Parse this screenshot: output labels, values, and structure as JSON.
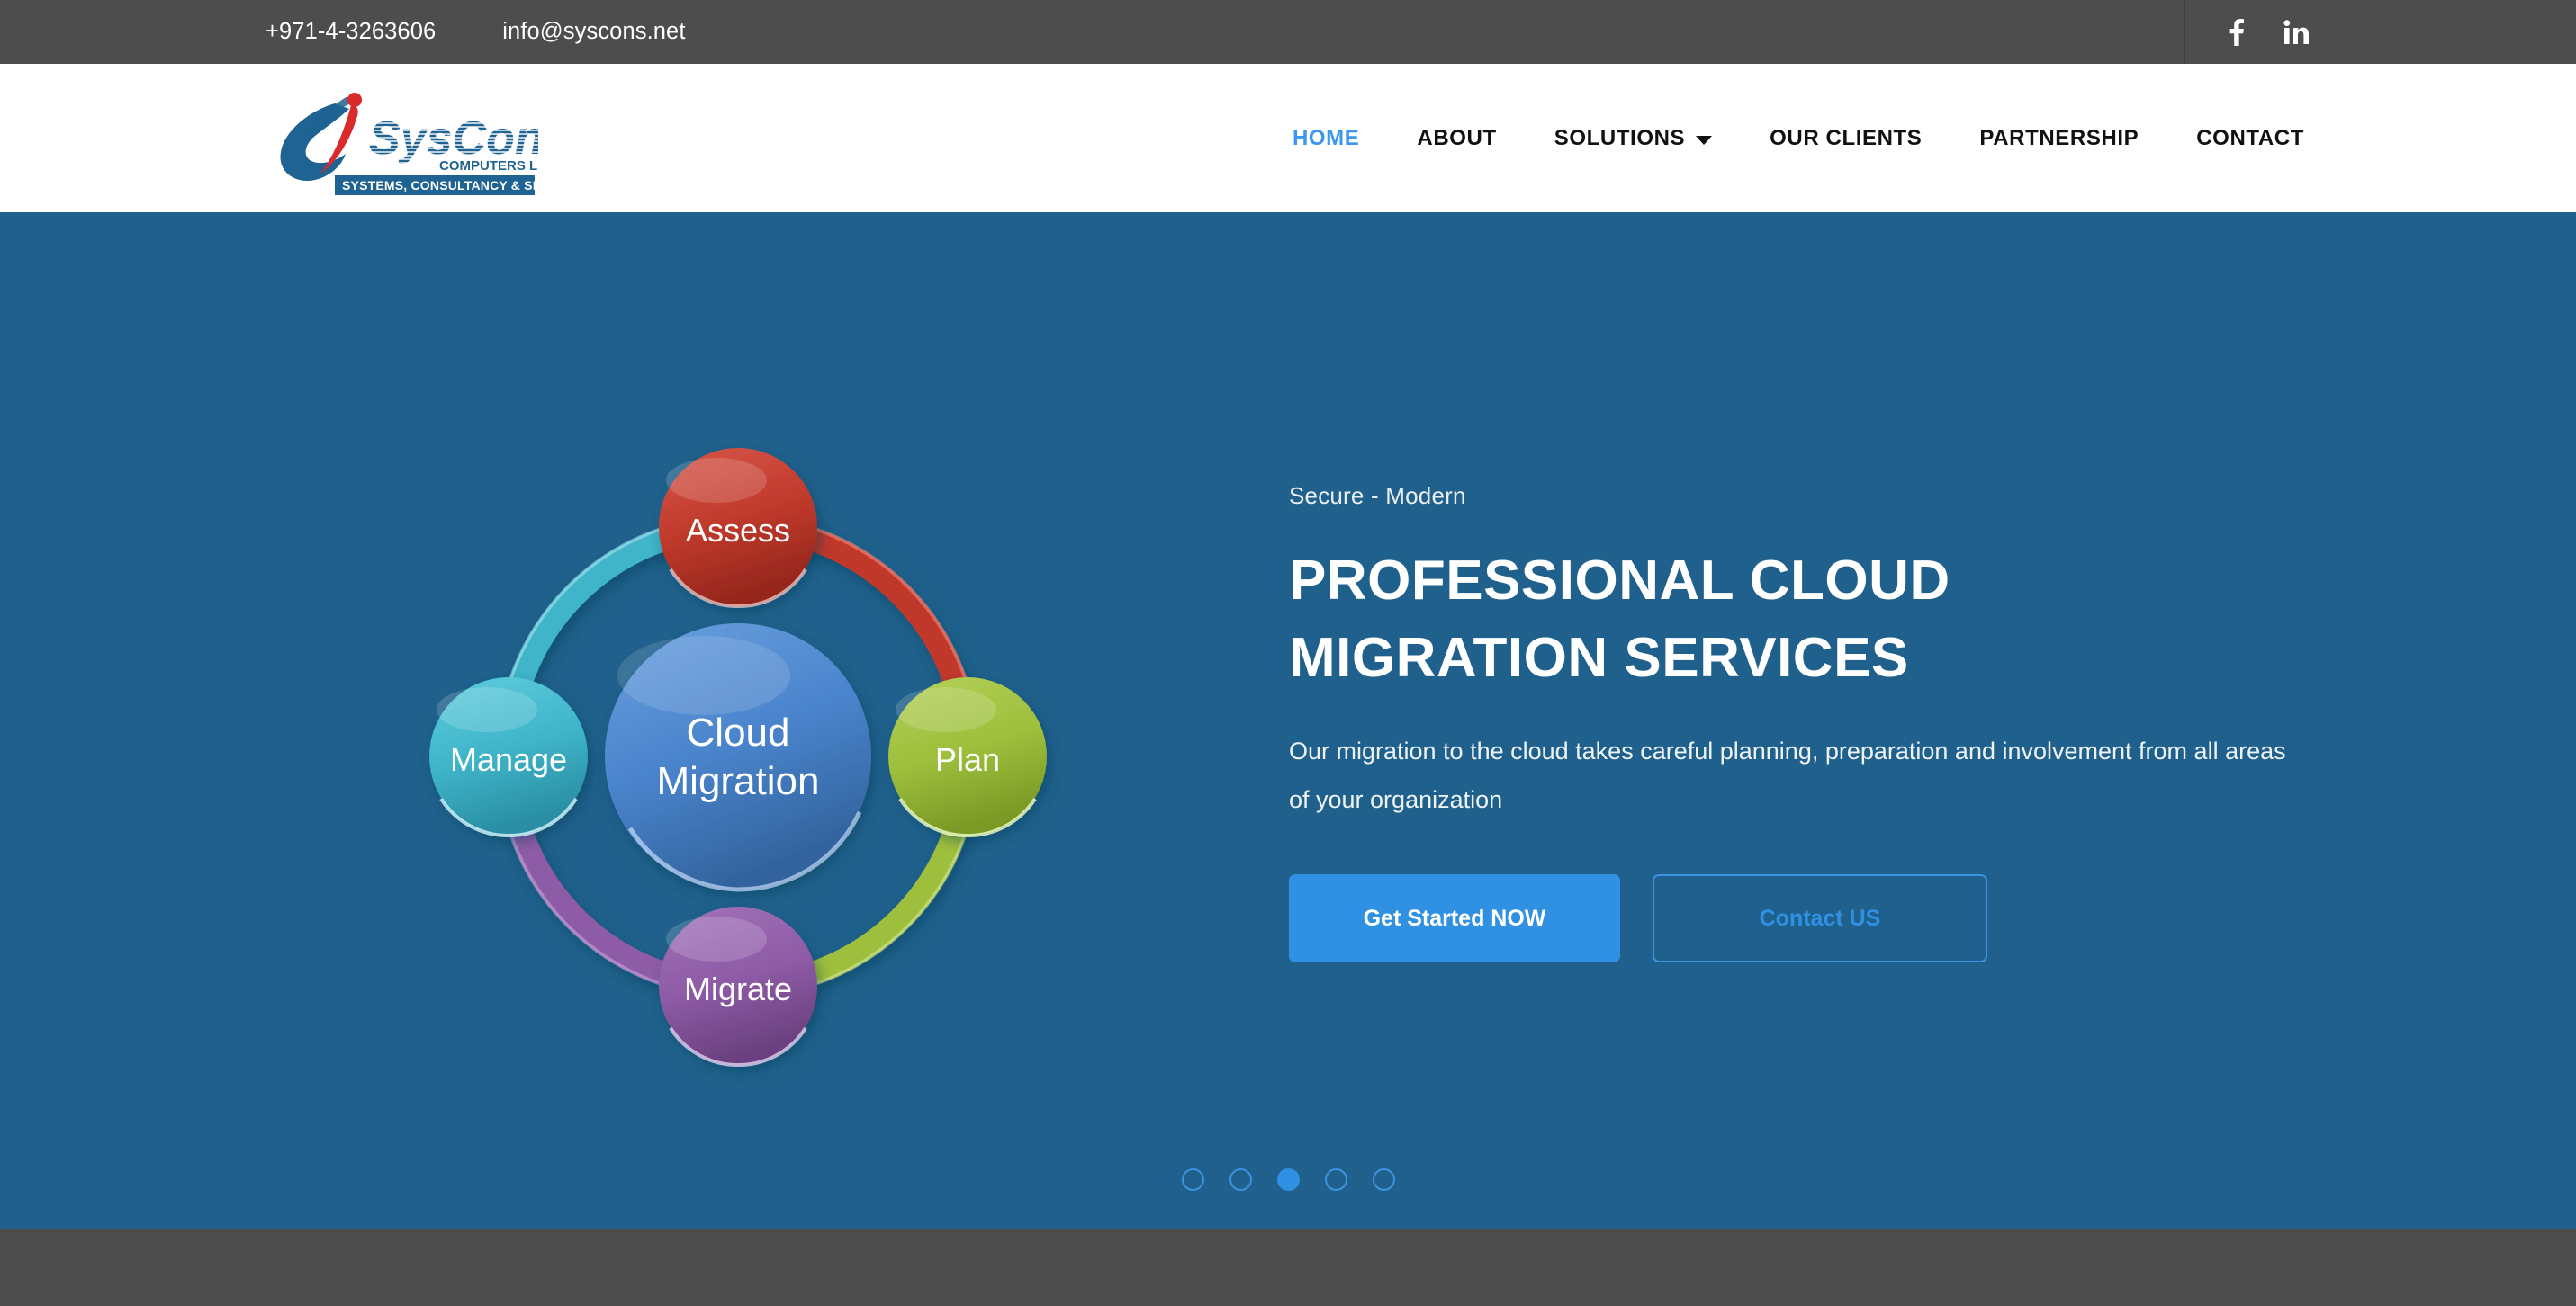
{
  "topbar": {
    "phone": "+971-4-3263606",
    "email": "info@syscons.net",
    "social": [
      {
        "name": "facebook-icon",
        "label": "f"
      },
      {
        "name": "linkedin-icon",
        "label": "in"
      }
    ]
  },
  "logo": {
    "brand": "SysConS",
    "sub": "COMPUTERS LLC",
    "tagline": "SYSTEMS, CONSULTANCY & SERVICES",
    "blue": "#1f6392",
    "red": "#d92b2b"
  },
  "nav": {
    "items": [
      {
        "label": "HOME",
        "active": true,
        "caret": false
      },
      {
        "label": "ABOUT",
        "active": false,
        "caret": false
      },
      {
        "label": "SOLUTIONS",
        "active": false,
        "caret": true
      },
      {
        "label": "OUR CLIENTS",
        "active": false,
        "caret": false
      },
      {
        "label": "PARTNERSHIP",
        "active": false,
        "caret": false
      },
      {
        "label": "CONTACT",
        "active": false,
        "caret": false
      }
    ]
  },
  "hero": {
    "background": "#1f618c",
    "kicker": "Secure - Modern",
    "headline_line1": "PROFESSIONAL CLOUD",
    "headline_line2": "MIGRATION SERVICES",
    "subcopy": "Our migration to the cloud takes careful planning, preparation and involvement from all areas of your organization",
    "primary_button": "Get Started NOW",
    "outline_button": "Contact US",
    "accent": "#3090e2"
  },
  "diagram": {
    "center_line1": "Cloud",
    "center_line2": "Migration",
    "center_color": "#4a86d0",
    "nodes": [
      {
        "label": "Assess",
        "position": "top",
        "color": "#c0392b"
      },
      {
        "label": "Plan",
        "position": "right",
        "color": "#9dbf3c"
      },
      {
        "label": "Migrate",
        "position": "bottom",
        "color": "#8e5ba6"
      },
      {
        "label": "Manage",
        "position": "left",
        "color": "#3fb4c9"
      }
    ]
  },
  "carousel": {
    "total": 5,
    "active_index": 2
  }
}
